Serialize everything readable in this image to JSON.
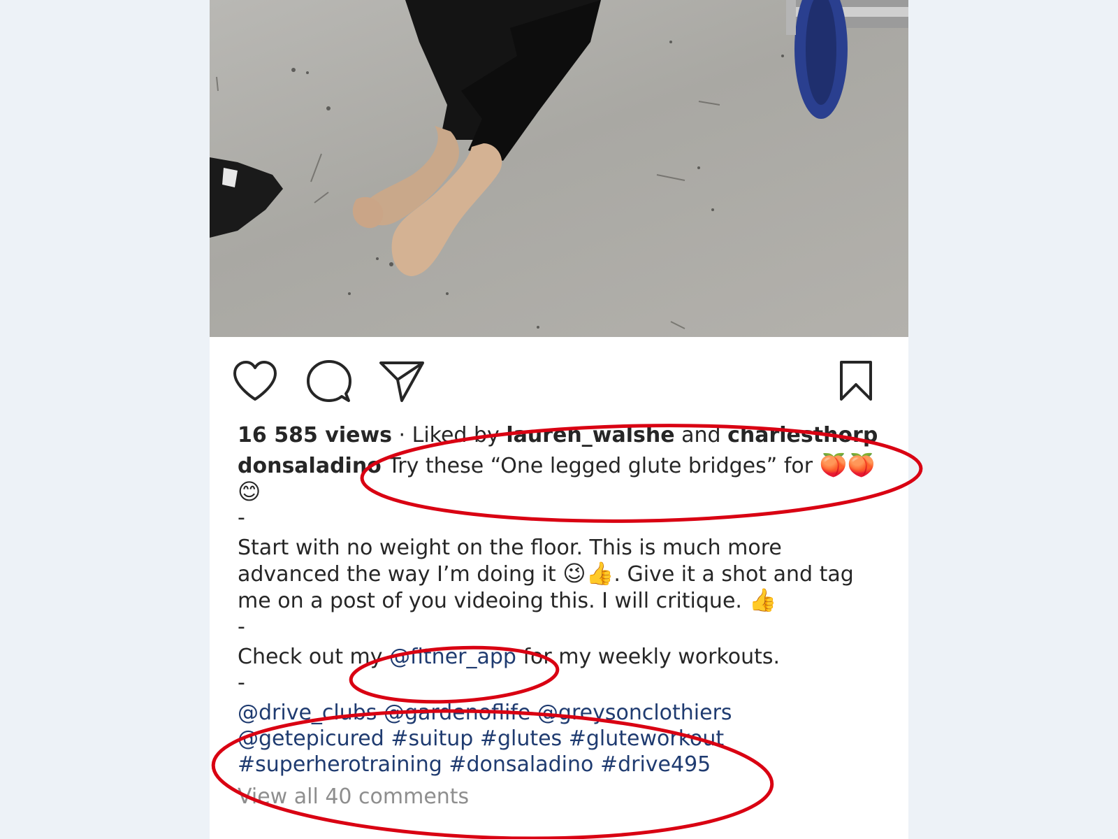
{
  "post": {
    "views": "16 585 views",
    "liked_prefix": " · Liked by ",
    "liked_user_1": "lauren_walshe",
    "liked_and": " and ",
    "liked_user_2": "charlesthorp",
    "author": "donsaladino",
    "caption_line1": " Try these “One legged glute bridges” for ",
    "emoji_peach": "🍑",
    "emoji_smile": "😊",
    "dash": "-",
    "para_line1": "Start with no weight on the floor. This is much more",
    "para_line2_a": "advanced the way I’m doing it ",
    "emoji_wink": "😉",
    "emoji_thumbs": "👍",
    "para_line2_b": ". Give it a shot and tag",
    "para_line3": "me on a post of you videoing this. I will critique. ",
    "checkout_a": "Check out my ",
    "checkout_mention": "@fitner_app",
    "checkout_b": " for my weekly workouts.",
    "tags": [
      [
        "@drive_clubs",
        "@gardenoflife",
        "@greysonclothiers"
      ],
      [
        "@getepicured",
        "#suitup",
        "#glutes",
        "#gluteworkout"
      ],
      [
        "#superherotraining",
        "#donsaladino",
        "#drive495"
      ]
    ],
    "view_comments": "View all 40 comments"
  },
  "icons": {
    "like": "heart-icon",
    "comment": "comment-icon",
    "share": "paper-plane-icon",
    "save": "bookmark-icon"
  },
  "colors": {
    "link": "#1f3b70",
    "annotation": "#d90012",
    "muted": "#8e8e8e"
  }
}
